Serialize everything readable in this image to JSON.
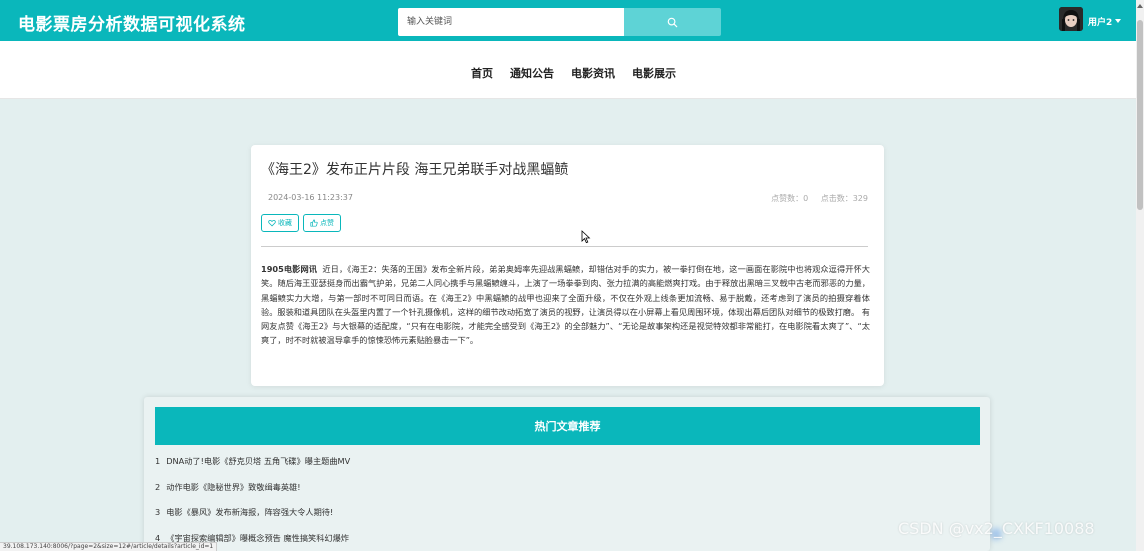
{
  "header": {
    "site_title": "电影票房分析数据可视化系统",
    "search_placeholder": "输入关键词",
    "user_label": "用户2",
    "colors": {
      "accent": "#0ab7bb",
      "search_button": "#5ed3d6"
    }
  },
  "nav": {
    "items": [
      {
        "label": "首页"
      },
      {
        "label": "通知公告"
      },
      {
        "label": "电影资讯"
      },
      {
        "label": "电影展示"
      }
    ]
  },
  "article": {
    "title": "《海王2》发布正片片段 海王兄弟联手对战黑蝠鲼",
    "date": "2024-03-16 11:23:37",
    "likes_label": "点赞数：0",
    "clicks_label": "点击数：329",
    "favorite_button": "收藏",
    "like_button": "点赞",
    "source": "1905电影网讯",
    "body": "近日，《海王2：失落的王国》发布全新片段，弟弟奥姆率先迎战黑蝠鲼，却错估对手的实力，被一拳打倒在地，这一画面在影院中也将观众逗得开怀大笑。随后海王亚瑟挺身而出霸气护弟，兄弟二人同心携手与黑蝠鲼缠斗，上演了一场拳拳到肉、张力拉满的高能燃爽打戏。由于释放出黑暗三叉戟中古老而邪恶的力量，黑蝠鲼实力大增，与第一部时不可同日而语。在《海王2》中黑蝠鲼的战甲也迎来了全面升级，不仅在外观上线条更加流畅、易于脱戴，还考虑到了演员的拍摄穿着体验。服装和道具团队在头盔里内置了一个针孔摄像机，这样的细节改动拓宽了演员的视野，让演员得以在小屏幕上看见周围环境，体现出幕后团队对细节的极致打磨。 有网友点赞《海王2》与大银幕的适配度，“只有在电影院，才能完全感受到《海王2》的全部魅力”、“无论是故事架构还是视觉特效都非常能打，在电影院看太爽了”、“太爽了，时不时就被温导拿手的惊悚恐怖元素贴脸暴击一下”。"
  },
  "hot": {
    "title": "热门文章推荐",
    "items": [
      {
        "num": "1",
        "text": "DNA动了!电影《舒克贝塔 五角飞碟》曝主题曲MV"
      },
      {
        "num": "2",
        "text": "动作电影《隐秘世界》致敬缉毒英雄!"
      },
      {
        "num": "3",
        "text": "电影《暴风》发布新海报，阵容强大令人期待!"
      },
      {
        "num": "4",
        "text": "《宇宙探索编辑部》曝概念预告 魔性搞笑科幻爆炸"
      }
    ]
  },
  "status_url": "39.108.173.140:8006/?page=2&size=12#/article/details?article_id=1",
  "watermark": "CSDN @vx2_CXKF10088",
  "icons": [
    "search-icon",
    "heart-icon",
    "thumb-up-icon",
    "user-caret-icon",
    "cursor-icon"
  ]
}
